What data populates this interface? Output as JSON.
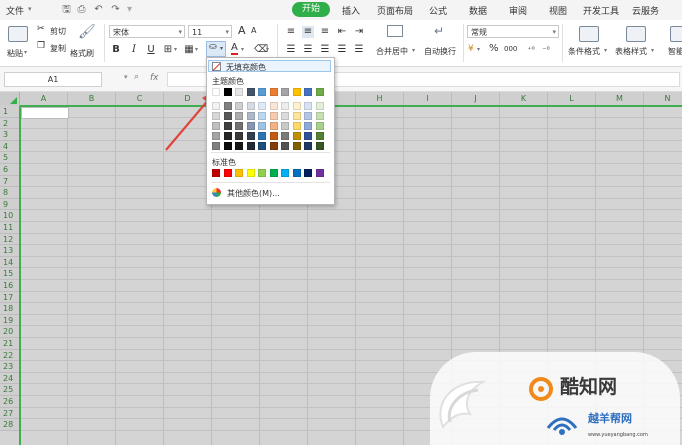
{
  "tabs": {
    "file": "文件",
    "start": "开始",
    "insert": "插入",
    "page_layout": "页面布局",
    "formula": "公式",
    "data": "数据",
    "review": "审阅",
    "view": "视图",
    "dev_tools": "开发工具",
    "cloud": "云服务"
  },
  "ribbon": {
    "paste": "粘贴",
    "cut": "剪切",
    "copy": "复制",
    "format_painter": "格式刷",
    "font_name": "宋体",
    "font_size": "11",
    "merge_center": "合并居中",
    "wrap_text": "自动换行",
    "number_format": "常规",
    "cond_format": "条件格式",
    "table_style": "表格样式",
    "smart_tools": "智能",
    "bold": "B",
    "italic": "I",
    "underline": "U",
    "grow_font": "A",
    "shrink_font": "A",
    "percent": "%",
    "comma": "000"
  },
  "formula_bar": {
    "cell_ref": "A1",
    "fx": "fx"
  },
  "color_menu": {
    "no_fill": "无填充颜色",
    "theme_colors": "主题颜色",
    "standard_colors": "标准色",
    "more_colors": "其他颜色(M)...",
    "theme_top": [
      "#ffffff",
      "#000000",
      "#e7e6e6",
      "#44546a",
      "#5b9bd5",
      "#ed7d31",
      "#a5a5a5",
      "#ffc000",
      "#4472c4",
      "#70ad47"
    ],
    "theme_shades": [
      [
        "#f2f2f2",
        "#7f7f7f",
        "#d0cece",
        "#d6dce4",
        "#deebf6",
        "#fbe5d5",
        "#ededed",
        "#fff2cc",
        "#d9e2f3",
        "#e2efd9"
      ],
      [
        "#d8d8d8",
        "#595959",
        "#aeabab",
        "#adb9ca",
        "#bdd7ee",
        "#f7cbac",
        "#dbdbdb",
        "#fee599",
        "#b4c6e7",
        "#c5e0b3"
      ],
      [
        "#bfbfbf",
        "#3f3f3f",
        "#757070",
        "#8496b0",
        "#9dc3e6",
        "#f4b183",
        "#c9c9c9",
        "#ffd965",
        "#8eaadb",
        "#a8d08d"
      ],
      [
        "#a5a5a5",
        "#262626",
        "#3a3838",
        "#323f4f",
        "#2e75b5",
        "#c55a11",
        "#7b7b7b",
        "#bf9000",
        "#2f5496",
        "#538135"
      ],
      [
        "#7f7f7f",
        "#0c0c0c",
        "#171616",
        "#222a35",
        "#1e4e79",
        "#843c0b",
        "#525252",
        "#7f6000",
        "#1f3864",
        "#375623"
      ]
    ],
    "standard": [
      "#c00000",
      "#ff0000",
      "#ffc000",
      "#ffff00",
      "#92d050",
      "#00b050",
      "#00b0f0",
      "#0070c0",
      "#002060",
      "#7030a0"
    ]
  },
  "sheet": {
    "columns": [
      "A",
      "B",
      "C",
      "D",
      "E",
      "F",
      "G",
      "H",
      "I",
      "J",
      "K",
      "L",
      "M",
      "N"
    ],
    "rows": [
      "1",
      "2",
      "3",
      "4",
      "5",
      "6",
      "7",
      "8",
      "9",
      "10",
      "11",
      "12",
      "13",
      "14",
      "15",
      "16",
      "17",
      "18",
      "19",
      "20",
      "21",
      "22",
      "23",
      "24",
      "25",
      "26",
      "27",
      "28"
    ]
  },
  "watermark": {
    "site_name": "酷知网",
    "site_name2": "越羊帮网",
    "url": "www.yueyangbang.com"
  },
  "colors": {
    "accent_green": "#2fae4a",
    "arrow_red": "#e0443a",
    "sheet_gray": "#d4d4d4"
  }
}
